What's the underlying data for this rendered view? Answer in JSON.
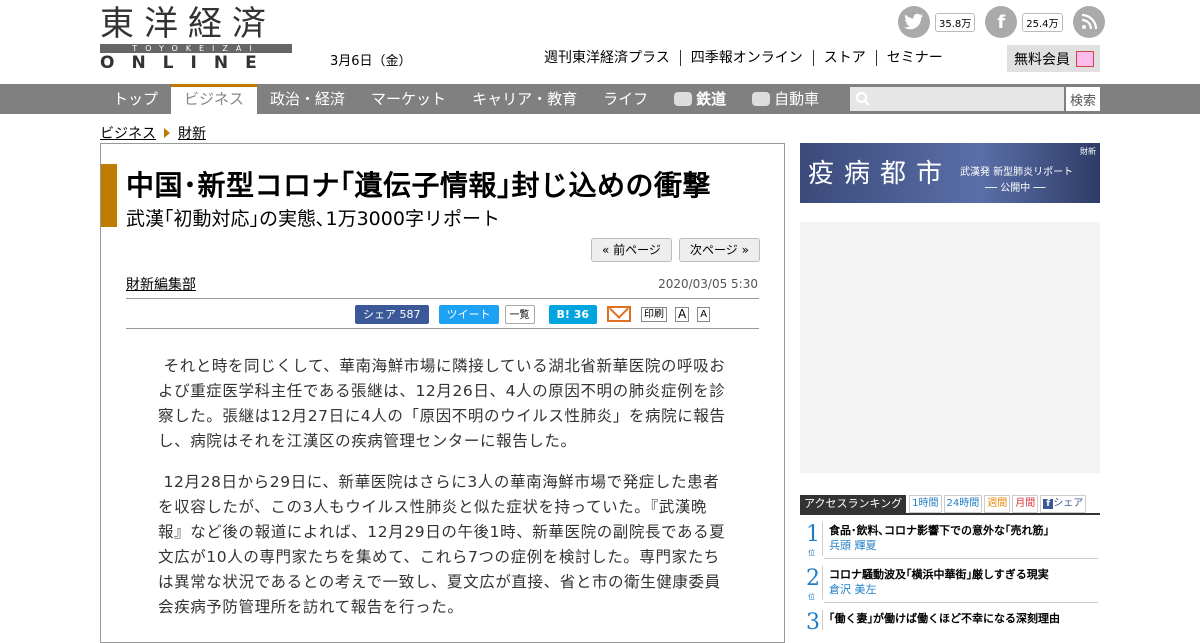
{
  "header": {
    "logo_kanji": "東洋経済",
    "logo_bar": "TOYOKEIZAI",
    "logo_online": "ONLINE",
    "date": "3月6日（金）",
    "social": {
      "twitter_count": "35.8万",
      "facebook_count": "25.4万",
      "twitter_icon": "twitter-icon",
      "facebook_icon": "facebook-icon",
      "rss_icon": "rss-icon"
    },
    "links": [
      "週刊東洋経済プラス",
      "四季報オンライン",
      "ストア",
      "セミナー"
    ],
    "member_label": "無料会員"
  },
  "nav": {
    "items": [
      "トップ",
      "ビジネス",
      "政治・経済",
      "マーケット",
      "キャリア・教育",
      "ライフ",
      "鉄道",
      "自動車"
    ],
    "active": "ビジネス",
    "search_button": "検索"
  },
  "breadcrumb": [
    "ビジネス",
    "財新"
  ],
  "article": {
    "title": "中国･新型コロナ｢遺伝子情報｣封じ込めの衝撃",
    "subtitle": "武漢｢初動対応｣の実態､1万3000字リポート",
    "prev_page": "« 前ページ",
    "next_page": "次ページ »",
    "author": "財新編集部",
    "pubdate": "2020/03/05 5:30",
    "share": {
      "facebook_label": "シェア",
      "facebook_count": "587",
      "tweet_label": "ツイート",
      "list_label": "一覧",
      "hatena_count": "36",
      "print_label": "印刷",
      "font_large": "A",
      "font_small": "A"
    },
    "paragraphs": [
      "それと時を同じくして、華南海鮮市場に隣接している湖北省新華医院の呼吸および重症医学科主任である張継は、12月26日、4人の原因不明の肺炎症例を診察した。張継は12月27日に4人の「原因不明のウイルス性肺炎」を病院に報告し、病院はそれを江漢区の疾病管理センターに報告した。",
      "12月28日から29日に、新華医院はさらに3人の華南海鮮市場で発症した患者を収容したが、この3人もウイルス性肺炎と似た症状を持っていた。『武漢晩報』など後の報道によれば、12月29日の午後1時、新華医院の副院長である夏文広が10人の専門家たちを集めて、これら7つの症例を検討した。専門家たちは異常な状況であるとの考えで一致し、夏文広が直接、省と市の衛生健康委員会疾病予防管理所を訪れて報告を行った。"
    ]
  },
  "sidebar": {
    "ad_title": "疫病都市",
    "ad_sub1": "武漢発 新型肺炎リポート",
    "ad_sub2": "── 公開中 ──",
    "ad_mark": "財新",
    "ranking_label": "アクセスランキング",
    "ranking_tabs": [
      "1時間",
      "24時間",
      "週間",
      "月間",
      "シェア"
    ],
    "ranking": [
      {
        "rank": "1",
        "unit": "位",
        "title": "食品･飲料､コロナ影響下での意外な｢売れ筋｣",
        "author": "兵頭 輝夏"
      },
      {
        "rank": "2",
        "unit": "位",
        "title": "コロナ騒動波及｢横浜中華街｣厳しすぎる現実",
        "author": "倉沢 美左"
      },
      {
        "rank": "3",
        "unit": "位",
        "title": "｢働く妻｣が働けば働くほど不幸になる深刻理由",
        "author": ""
      }
    ]
  },
  "colors": {
    "accent": "#c07a00",
    "nav_bg": "#808080",
    "link_blue": "#1e7ec8"
  }
}
